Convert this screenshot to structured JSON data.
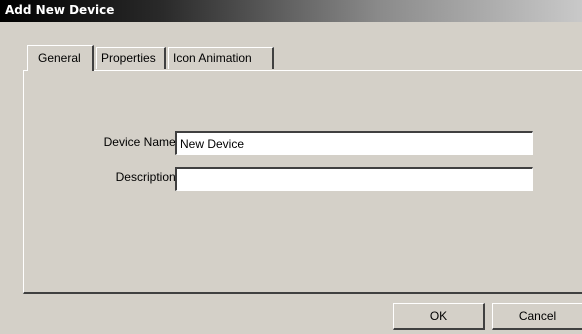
{
  "window": {
    "title": "Add New Device"
  },
  "tabs": [
    {
      "label": "General",
      "active": true
    },
    {
      "label": "Properties",
      "active": false
    },
    {
      "label": "Icon Animation",
      "active": false
    }
  ],
  "general": {
    "device_name_label": "Device Name:",
    "device_name_value": "New Device",
    "description_label": "Description:",
    "description_value": ""
  },
  "buttons": {
    "ok_label": "OK",
    "cancel_label": "Cancel"
  },
  "colors": {
    "dialog_background": "#d4d0c8",
    "title_bar_start": "#000000",
    "title_bar_end": "#c9c9c9",
    "title_text": "#ffffff"
  }
}
